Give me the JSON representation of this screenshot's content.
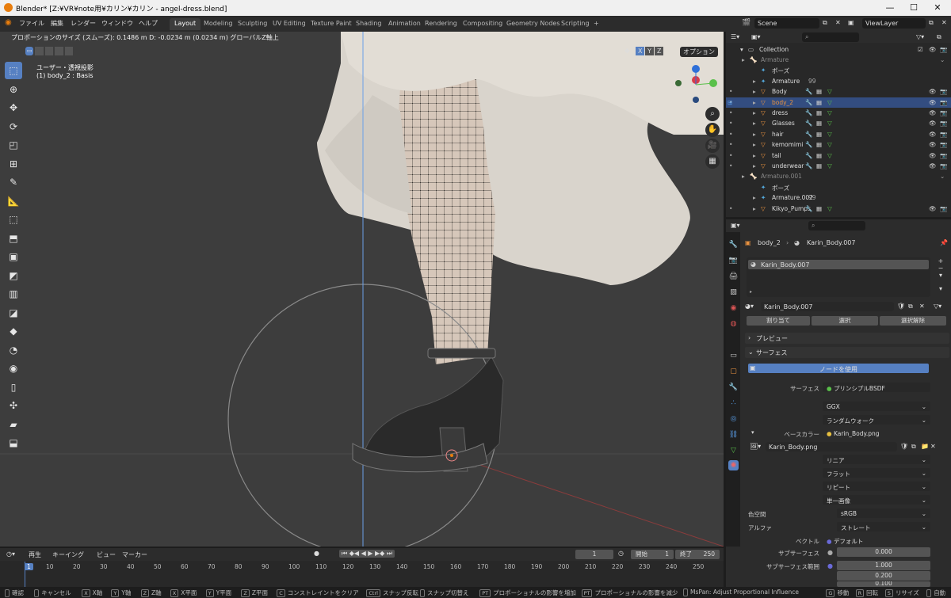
{
  "titlebar": {
    "title": "Blender* [Z:¥VR¥note用¥カリン¥カリン - angel-dress.blend]",
    "min": "—",
    "max": "☐",
    "close": "✕"
  },
  "menu": {
    "file": "ファイル",
    "edit": "編集",
    "render": "レンダー",
    "window": "ウィンドウ",
    "help": "ヘルプ"
  },
  "workspaces": [
    "Layout",
    "Modeling",
    "Sculpting",
    "UV Editing",
    "Texture Paint",
    "Shading",
    "Animation",
    "Rendering",
    "Compositing",
    "Geometry Nodes",
    "Scripting",
    "+"
  ],
  "scene": {
    "name": "Scene",
    "viewlayer": "ViewLayer"
  },
  "viewport": {
    "header_info": "プロポーションのサイズ (スムーズ): 0.1486 m  D: -0.0234 m (0.0234 m) グローバルZ軸上",
    "view_name": "ユーザー・透視投影",
    "object_info": "(1) body_2 : Basis",
    "options": "オプション",
    "axes": [
      "X",
      "Y",
      "Z"
    ],
    "gizmo": {
      "x": "X",
      "y": "Y",
      "z": "Z"
    }
  },
  "outliner": {
    "search": "",
    "collection": "Collection",
    "rows": [
      {
        "name": "Armature",
        "indent": 1,
        "icon": "armature-icon",
        "dim": true
      },
      {
        "name": "ポーズ",
        "indent": 2,
        "icon": "pose-icon"
      },
      {
        "name": "Armature",
        "indent": 2,
        "icon": "armature-data-icon",
        "extra": "99"
      },
      {
        "name": "Body",
        "indent": 2,
        "icon": "mesh-icon",
        "vis": true
      },
      {
        "name": "body_2",
        "indent": 2,
        "icon": "mesh-icon",
        "vis": true,
        "selected": true
      },
      {
        "name": "dress",
        "indent": 2,
        "icon": "mesh-icon",
        "vis": true
      },
      {
        "name": "Glasses",
        "indent": 2,
        "icon": "mesh-icon",
        "vis": true
      },
      {
        "name": "hair",
        "indent": 2,
        "icon": "mesh-icon",
        "vis": true
      },
      {
        "name": "kemomimi",
        "indent": 2,
        "icon": "mesh-icon",
        "vis": true
      },
      {
        "name": "tail",
        "indent": 2,
        "icon": "mesh-icon",
        "vis": true
      },
      {
        "name": "underwear",
        "indent": 2,
        "icon": "mesh-icon",
        "vis": true
      },
      {
        "name": "Armature.001",
        "indent": 1,
        "icon": "armature-icon",
        "dim": true
      },
      {
        "name": "ポーズ",
        "indent": 2,
        "icon": "pose-icon"
      },
      {
        "name": "Armature.002",
        "indent": 2,
        "icon": "armature-data-icon",
        "extra": "99"
      },
      {
        "name": "Kikyo_Pumps",
        "indent": 2,
        "icon": "mesh-icon",
        "vis": true
      }
    ]
  },
  "properties": {
    "breadcrumb_obj": "body_2",
    "breadcrumb_mat": "Karin_Body.007",
    "slot": "Karin_Body.007",
    "material_name": "Karin_Body.007",
    "assign": "割り当て",
    "select": "選択",
    "deselect": "選択解除",
    "preview": "プレビュー",
    "surface_panel": "サーフェス",
    "use_nodes": "ノードを使用",
    "surface_label": "サーフェス",
    "surface_value": "プリンシプルBSDF",
    "ggx": "GGX",
    "random_walk": "ランダムウォーク",
    "base_color_label": "ベースカラー",
    "base_color_value": "Karin_Body.png",
    "image_name": "Karin_Body.png",
    "linear": "リニア",
    "flat": "フラット",
    "repeat": "リピート",
    "single_image": "単一画像",
    "colorspace_label": "色空間",
    "colorspace_value": "sRGB",
    "alpha_label": "アルファ",
    "alpha_value": "ストレート",
    "vector_label": "ベクトル",
    "vector_value": "デフォルト",
    "subsurface_label": "サブサーフェス",
    "subsurface_value": "0.000",
    "subsurface_radius_label": "サブサーフェス範囲",
    "radius": [
      "1.000",
      "0.200",
      "0.100"
    ]
  },
  "timeline": {
    "play": "再生",
    "keying": "キーイング",
    "view": "ビュー",
    "marker": "マーカー",
    "current": "1",
    "start_label": "開始",
    "start": "1",
    "end_label": "終了",
    "end": "250",
    "frames": [
      "1",
      "10",
      "20",
      "30",
      "40",
      "50",
      "60",
      "70",
      "80",
      "90",
      "100",
      "110",
      "120",
      "130",
      "140",
      "150",
      "160",
      "170",
      "180",
      "190",
      "200",
      "210",
      "220",
      "230",
      "240",
      "250"
    ]
  },
  "status": {
    "items": [
      "確認",
      "キャンセル",
      "X軸",
      "Y軸",
      "Z軸",
      "X平面",
      "Y平面",
      "Z平面",
      "コンストレイントをクリア",
      "スナップ反転",
      "スナップ切替え",
      "プロポーショナルの影響を増加",
      "プロポーショナルの影響を減少",
      "MsPan: Adjust Proportional Influence",
      "移動",
      "回転",
      "リサイズ",
      "自動"
    ],
    "keys": [
      "",
      "",
      "X",
      "Y",
      "Z",
      "X",
      "Y",
      "Z",
      "C",
      "Ctrl",
      "",
      "PT",
      "PT",
      "",
      "G",
      "R",
      "S",
      ""
    ]
  },
  "colors": {
    "accent": "#5680c2",
    "selection": "#334d80",
    "mesh": "#e89240"
  }
}
